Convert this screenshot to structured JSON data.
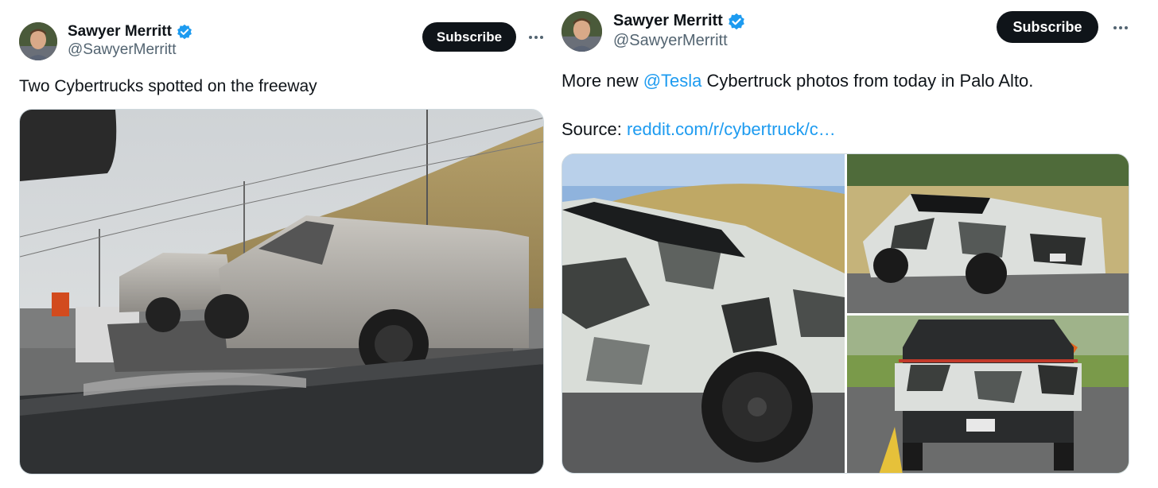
{
  "tweets": [
    {
      "author": {
        "display_name": "Sawyer Merritt",
        "handle": "@SawyerMerritt",
        "verified": true,
        "avatar_icon": "avatar-photo"
      },
      "subscribe_label": "Subscribe",
      "more_icon": "more-horizontal-icon",
      "text": "Two Cybertrucks spotted on the freeway",
      "media": {
        "count": 1,
        "subject": "cybertrucks-on-car-carrier"
      }
    },
    {
      "author": {
        "display_name": "Sawyer Merritt",
        "handle": "@SawyerMerritt",
        "verified": true,
        "avatar_icon": "avatar-photo"
      },
      "subscribe_label": "Subscribe",
      "more_icon": "more-horizontal-icon",
      "text_prefix": "More new ",
      "mention": "@Tesla",
      "text_suffix": " Cybertruck photos from today in Palo Alto.",
      "source_label": "Source: ",
      "source_link": "reddit.com/r/cybertruck/c…",
      "media": {
        "count": 3,
        "subject": "camouflaged-cybertruck"
      }
    }
  ],
  "colors": {
    "text": "#0f1419",
    "secondary": "#536471",
    "link": "#1d9bf0",
    "verified": "#1d9bf0",
    "button_bg": "#0f1419",
    "button_text": "#ffffff",
    "border": "#cfd9de"
  }
}
